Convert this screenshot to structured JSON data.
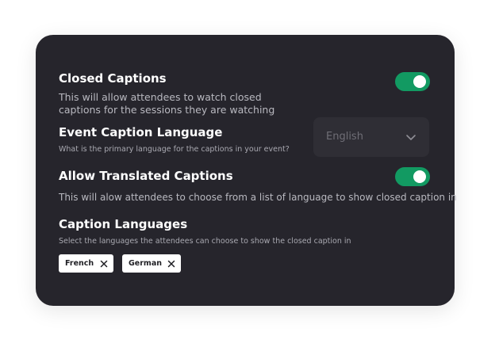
{
  "closed_captions": {
    "title": "Closed Captions",
    "description": "This will allow attendees to watch closed captions for the sessions they are watching",
    "enabled": true
  },
  "event_caption_language": {
    "title": "Event Caption Language",
    "description": "What is the primary language for the captions in your event?",
    "selected": "English"
  },
  "allow_translated": {
    "title": "Allow Translated Captions",
    "description": "This will alow attendees to choose from a list of language to show closed caption in",
    "enabled": true
  },
  "caption_languages": {
    "title": "Caption Languages",
    "description": "Select the languages the attendees can choose to show the closed caption in",
    "chips": [
      {
        "label": "French"
      },
      {
        "label": "German"
      }
    ]
  },
  "colors": {
    "card": "#26252c",
    "toggle_on": "#129a62",
    "select_bg": "#2f2e35"
  },
  "icons": {
    "select": "chevron-down-icon",
    "chip_remove": "close-icon"
  }
}
